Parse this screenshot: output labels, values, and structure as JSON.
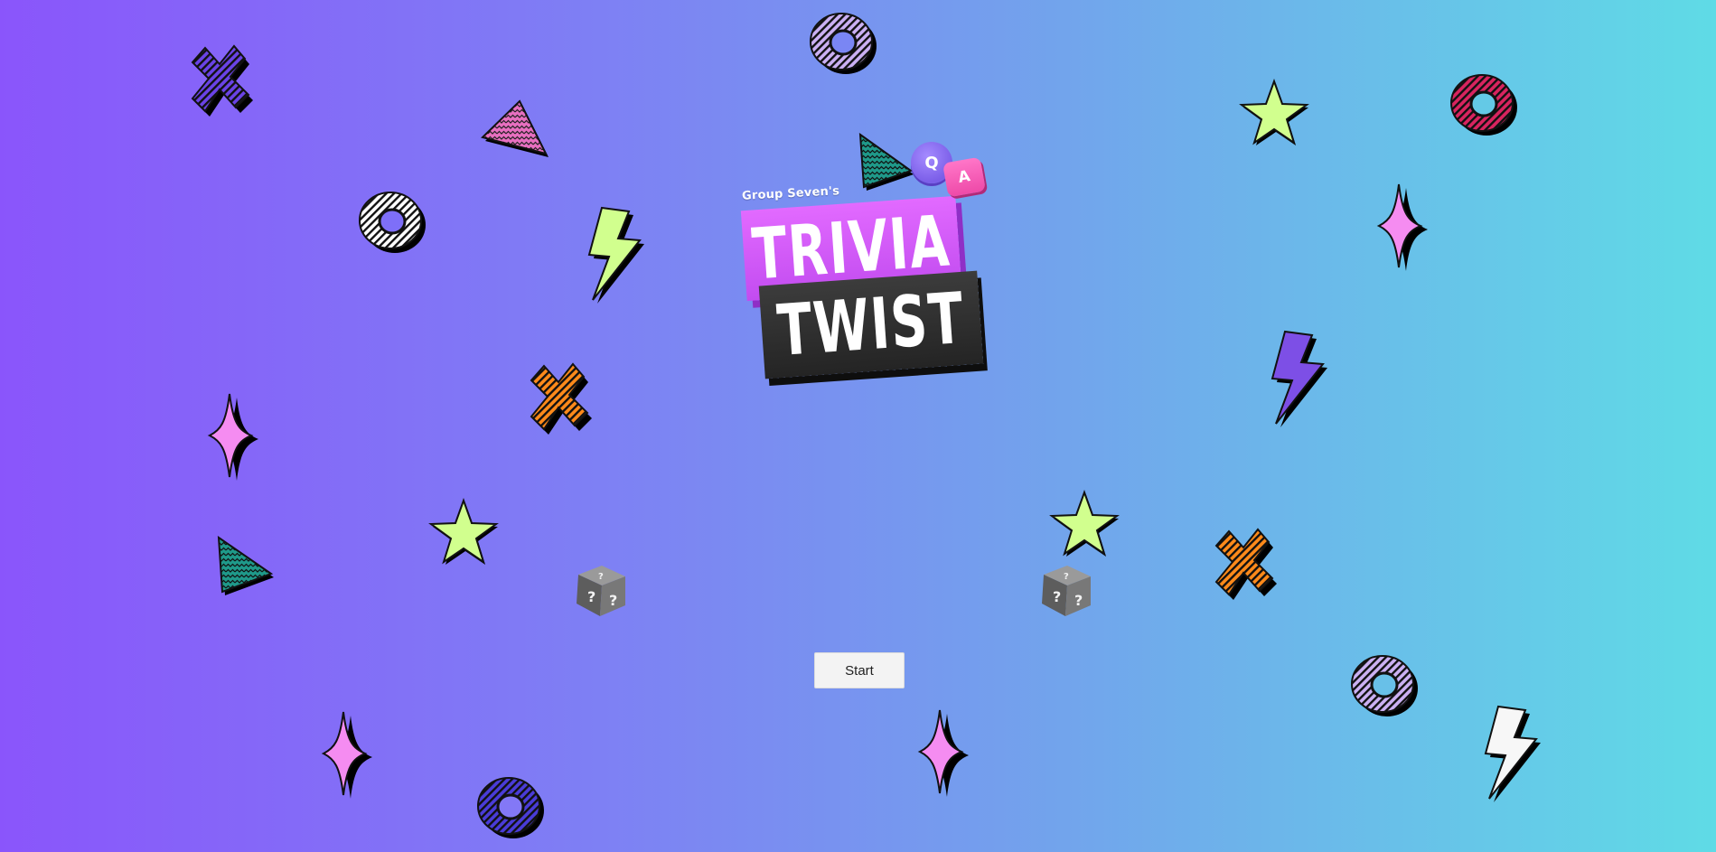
{
  "logo": {
    "group_label": "Group Seven's",
    "line1": "TRIVIA",
    "line2": "TWIST",
    "bubble_q": "Q",
    "bubble_a": "A"
  },
  "start_button": {
    "label": "Start"
  },
  "icons": {
    "dice": "question-dice-icon",
    "shapes": [
      "x-cross-icon",
      "triangle-icon",
      "ring-icon",
      "lightning-bolt-icon",
      "star-icon",
      "sparkle-icon"
    ]
  },
  "colors": {
    "gradient_left": "#8a55fb",
    "gradient_right": "#5fdbe6",
    "trivia_block": "#d65ef9",
    "twist_block": "#2f2f2f",
    "lime": "#d1ff8e",
    "pink": "#f58cf1",
    "orange": "#ff8a1a",
    "teal": "#1f9a8a",
    "crimson": "#d8245f",
    "lavender": "#c9aaf4",
    "indigo": "#4a3cd8",
    "violet": "#7d4fe6"
  }
}
